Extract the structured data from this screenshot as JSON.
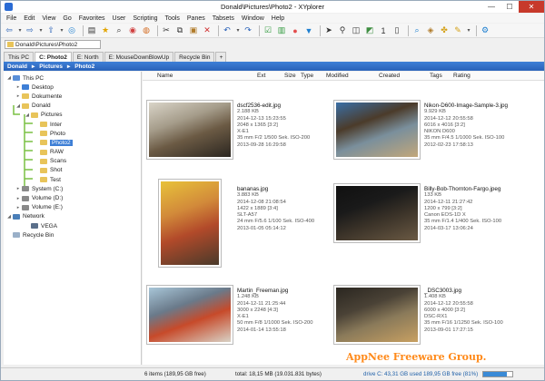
{
  "window": {
    "title": "Donald\\Pictures\\Photo2 - XYplorer",
    "min": "—",
    "max": "☐",
    "close": "✕"
  },
  "menu": [
    "File",
    "Edit",
    "View",
    "Go",
    "Favorites",
    "User",
    "Scripting",
    "Tools",
    "Panes",
    "Tabsets",
    "Window",
    "Help"
  ],
  "toolbar": {
    "icons": [
      {
        "name": "back-icon",
        "glyph": "⇦",
        "color": "#2a62b8"
      },
      {
        "name": "back-dropdown-icon",
        "glyph": "▾",
        "color": "#555"
      },
      {
        "name": "forward-icon",
        "glyph": "⇨",
        "color": "#2a62b8"
      },
      {
        "name": "forward-dropdown-icon",
        "glyph": "▾",
        "color": "#555"
      },
      {
        "name": "up-icon",
        "glyph": "⇧",
        "color": "#2a62b8"
      },
      {
        "name": "up-dropdown-icon",
        "glyph": "▾",
        "color": "#555"
      },
      {
        "name": "hotlist-icon",
        "glyph": "◎",
        "color": "#1e7fd0"
      },
      {
        "name": "sep",
        "glyph": ""
      },
      {
        "name": "list-icon",
        "glyph": "▤",
        "color": "#333"
      },
      {
        "name": "favorites-icon",
        "glyph": "★",
        "color": "#e2a400"
      },
      {
        "name": "find-files-icon",
        "glyph": "⌕",
        "color": "#333"
      },
      {
        "name": "stop-icon",
        "glyph": "◉",
        "color": "#d04040"
      },
      {
        "name": "media-icon",
        "glyph": "◍",
        "color": "#d46a1f"
      },
      {
        "name": "sep",
        "glyph": ""
      },
      {
        "name": "cut-icon",
        "glyph": "✂",
        "color": "#333"
      },
      {
        "name": "copy-icon",
        "glyph": "⧉",
        "color": "#333"
      },
      {
        "name": "paste-icon",
        "glyph": "▣",
        "color": "#b07b2a"
      },
      {
        "name": "delete-icon",
        "glyph": "✕",
        "color": "#d03030"
      },
      {
        "name": "sep",
        "glyph": ""
      },
      {
        "name": "undo-icon",
        "glyph": "↶",
        "color": "#2a62b8"
      },
      {
        "name": "undo-dropdown-icon",
        "glyph": "▾",
        "color": "#555"
      },
      {
        "name": "redo-icon",
        "glyph": "↷",
        "color": "#2a62b8"
      },
      {
        "name": "sep",
        "glyph": ""
      },
      {
        "name": "checklist-icon",
        "glyph": "☑",
        "color": "#2f9a3c"
      },
      {
        "name": "preview-icon",
        "glyph": "▥",
        "color": "#2f9a3c"
      },
      {
        "name": "color-filter-icon",
        "glyph": "●",
        "color": "#e34d4d"
      },
      {
        "name": "filter-icon",
        "glyph": "▼",
        "color": "#1e7fd0"
      },
      {
        "name": "sep",
        "glyph": ""
      },
      {
        "name": "send-icon",
        "glyph": "➤",
        "color": "#333"
      },
      {
        "name": "pin-icon",
        "glyph": "⚲",
        "color": "#333"
      },
      {
        "name": "dual-pane-icon",
        "glyph": "◫",
        "color": "#333"
      },
      {
        "name": "sync-icon",
        "glyph": "◩",
        "color": "#3e8e41"
      },
      {
        "name": "pane-one-icon",
        "glyph": "1",
        "color": "#333"
      },
      {
        "name": "pane-compare-icon",
        "glyph": "▯",
        "color": "#333"
      },
      {
        "name": "sep",
        "glyph": ""
      },
      {
        "name": "search-icon",
        "glyph": "⌕",
        "color": "#1e7fd0"
      },
      {
        "name": "tag-icon",
        "glyph": "◈",
        "color": "#b07b2a"
      },
      {
        "name": "puzzle-icon",
        "glyph": "✤",
        "color": "#d4a017"
      },
      {
        "name": "rename-icon",
        "glyph": "✎",
        "color": "#d4a017"
      },
      {
        "name": "tools-dropdown-icon",
        "glyph": "▾",
        "color": "#555"
      },
      {
        "name": "sep",
        "glyph": ""
      },
      {
        "name": "settings-icon",
        "glyph": "⚙",
        "color": "#1e7fd0"
      }
    ]
  },
  "address": "Donald\\Pictures\\Photo2",
  "tabs": [
    {
      "label": "This PC",
      "active": false
    },
    {
      "label": "C: Photo2",
      "active": true
    },
    {
      "label": "E: North",
      "active": false
    },
    {
      "label": "E: MouseDownBlowUp",
      "active": false
    },
    {
      "label": "Recycle Bin",
      "active": false
    },
    {
      "label": "+",
      "active": false
    }
  ],
  "breadcrumb": [
    "Donald",
    "▸",
    "Pictures",
    "▸",
    "Photo2"
  ],
  "tree": [
    {
      "label": "This PC",
      "indent": 0,
      "exp": "◢",
      "icon": "#5a8fd8"
    },
    {
      "label": "Desktop",
      "indent": 1,
      "exp": "▸",
      "icon": "#3e7fd6"
    },
    {
      "label": "Dokumente",
      "indent": 1,
      "exp": "▸",
      "icon": "#e8c45a"
    },
    {
      "label": "Donald",
      "indent": 1,
      "exp": "◢",
      "icon": "#e8c45a"
    },
    {
      "label": "Pictures",
      "indent": 2,
      "exp": "◢",
      "icon": "#e8c45a"
    },
    {
      "label": "Inter",
      "indent": 3,
      "exp": "",
      "icon": "#e8c45a"
    },
    {
      "label": "Photo",
      "indent": 3,
      "exp": "",
      "icon": "#e8c45a"
    },
    {
      "label": "Photo2",
      "indent": 3,
      "exp": "",
      "icon": "#e8c45a",
      "selected": true
    },
    {
      "label": "RAW",
      "indent": 3,
      "exp": "",
      "icon": "#e8c45a"
    },
    {
      "label": "Scans",
      "indent": 3,
      "exp": "",
      "icon": "#e8c45a"
    },
    {
      "label": "Shot",
      "indent": 3,
      "exp": "",
      "icon": "#e8c45a"
    },
    {
      "label": "Test",
      "indent": 3,
      "exp": "",
      "icon": "#e8c45a"
    },
    {
      "label": "System (C:)",
      "indent": 1,
      "exp": "▸",
      "icon": "#8a8a8a"
    },
    {
      "label": "Volume (D:)",
      "indent": 1,
      "exp": "▸",
      "icon": "#8a8a8a"
    },
    {
      "label": "Volume (E:)",
      "indent": 1,
      "exp": "▸",
      "icon": "#8a8a8a"
    },
    {
      "label": "Network",
      "indent": 0,
      "exp": "◢",
      "icon": "#4a7fb8"
    },
    {
      "label": "VEGA",
      "indent": 2,
      "exp": "",
      "icon": "#5a6f8a"
    },
    {
      "label": "Recycle Bin",
      "indent": 0,
      "exp": "",
      "icon": "#9ab0c8"
    }
  ],
  "columns": [
    "Name",
    "Ext",
    "Size",
    "Type",
    "Modified",
    "Created",
    "Tags",
    "Rating"
  ],
  "files": [
    {
      "name": "dscf2536-edit.jpg",
      "size": "2.188 KB",
      "date1": "2014-12-13 15:23:55",
      "dims": "2048 x 1365  [3:2]",
      "camera": "X-E1",
      "exif": "35 mm  F/2  1/500 Sek.  ISO-200",
      "date2": "2013-09-28 16:29:58",
      "colors": [
        "#d9d4c8",
        "#6b5a44",
        "#2b2620",
        "#a59c8a"
      ]
    },
    {
      "name": "Nikon-D600-Image-Sample-3.jpg",
      "size": "9.929 KB",
      "date1": "2014-12-12 20:55:58",
      "dims": "6016 x 4016  [3:2]",
      "camera": "NIKON D600",
      "exif": "35 mm  F/4.5  1/1000 Sek.  ISO-100",
      "date2": "2012-02-23 17:58:13",
      "colors": [
        "#3a6fa6",
        "#7a8f9c",
        "#c2a77a",
        "#4b3b2a"
      ]
    },
    {
      "name": "bananas.jpg",
      "size": "3.883 KB",
      "date1": "2014-12-08 21:08:54",
      "dims": "1422 x 1889  [3:4]",
      "camera": "SLT-A57",
      "exif": "24 mm  F/5.6  1/100 Sek.  ISO-400",
      "date2": "2013-01-05 05:14:12",
      "colors": [
        "#e8c23a",
        "#b24a2a",
        "#4a3a2a",
        "#d28a3a"
      ]
    },
    {
      "name": "Billy-Bob-Thornton-Fargo.jpeg",
      "size": "133 KB",
      "date1": "2014-12-11 21:27:42",
      "dims": "1200 x 799  [3:2]",
      "camera": "Canon EOS-1D X",
      "exif": "35 mm  F/1.4  1/400 Sek.  ISO-100",
      "date2": "2014-03-17 13:06:24",
      "colors": [
        "#101010",
        "#3a3228",
        "#6b5a44",
        "#1a1a1a"
      ]
    },
    {
      "name": "Martin_Freeman.jpg",
      "size": "1.248 KB",
      "date1": "2014-12-11 21:25:44",
      "dims": "3000 x 2248  [4:3]",
      "camera": "X-E1",
      "exif": "50 mm  F/8  1/1000 Sek.  ISO-200",
      "date2": "2014-01-14 13:55:18",
      "colors": [
        "#a8c6d8",
        "#c74a2a",
        "#d8d2c6",
        "#6a7a8a"
      ]
    },
    {
      "name": "_DSC3003.jpg",
      "size": "1.408 KB",
      "date1": "2014-12-12 20:55:58",
      "dims": "6000 x 4000  [3:2]",
      "camera": "DSC-RX1",
      "exif": "35 mm  F/16  1/1250 Sek.  ISO-100",
      "date2": "2013-09-01 17:27:15",
      "colors": [
        "#2a2620",
        "#8a7a5a",
        "#c8a062",
        "#4a4236"
      ]
    }
  ],
  "statusbar": {
    "items": "6 items (189,95 GB free)",
    "total": "total: 18,15 MB (19.031.831 bytes)",
    "drive": "drive C:  43,31 GB used  189,95 GB free (81%)",
    "percent_used": 0.81
  },
  "watermark": "AppNee Freeware Group."
}
